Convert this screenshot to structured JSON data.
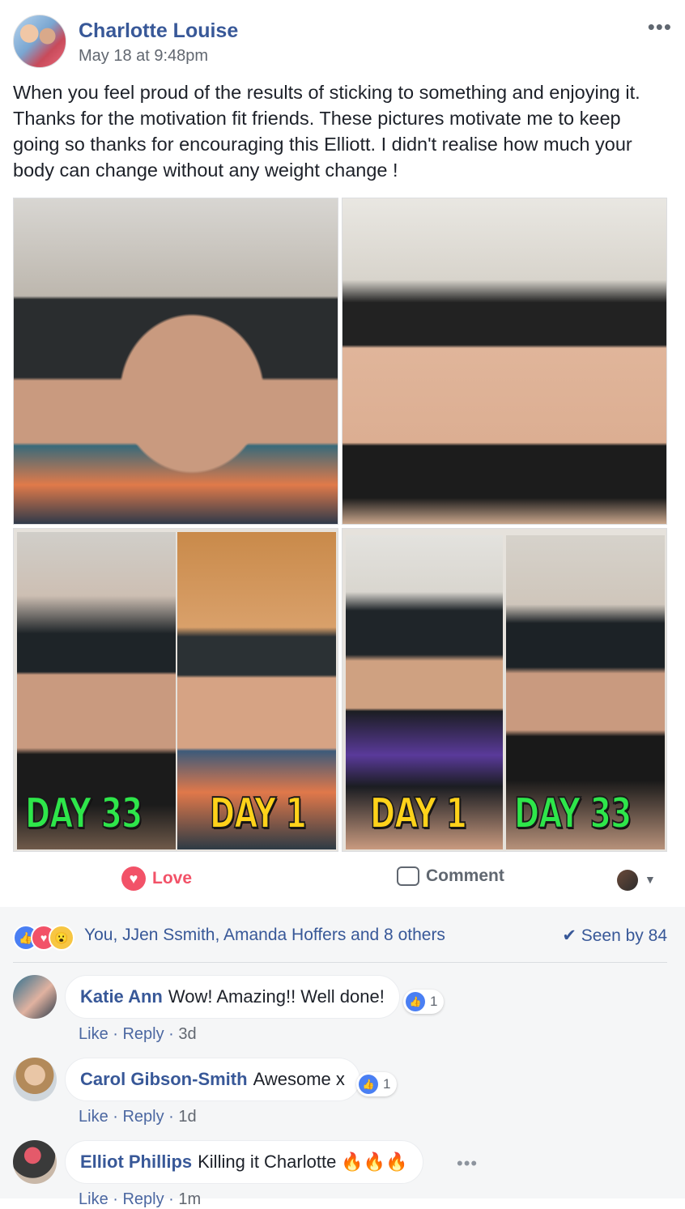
{
  "post": {
    "author": "Charlotte Louise",
    "timestamp": "May 18 at 9:48pm",
    "more_icon": "•••",
    "text": "When you feel proud of the results of sticking to something and enjoying it. Thanks for the motivation fit friends. These pictures motivate me to keep going so thanks for encouraging this Elliott. I didn't realise how much your body can change without any weight change !"
  },
  "photos": {
    "labels": [
      "DAY 33",
      "DAY 1",
      "DAY 1",
      "DAY 33"
    ]
  },
  "actions": {
    "love_label": "Love",
    "comment_label": "Comment",
    "heart_icon": "♥",
    "caret_icon": "▼"
  },
  "reactions": {
    "summary": "You, JJen Ssmith, Amanda Hoffers and 8 others",
    "seen": "✔ Seen by 84",
    "like_icon": "👍",
    "love_icon": "♥",
    "wow_icon": "😮"
  },
  "comments": [
    {
      "name": "Katie Ann",
      "text": "Wow! Amazing!! Well done!",
      "likes": "1",
      "like": "Like",
      "reply": "Reply",
      "time": "3d"
    },
    {
      "name": "Carol Gibson-Smith",
      "text": "Awesome x",
      "likes": "1",
      "like": "Like",
      "reply": "Reply",
      "time": "1d"
    },
    {
      "name": "Elliot Phillips",
      "text": "Killing it Charlotte 🔥🔥🔥",
      "like": "Like",
      "reply": "Reply",
      "time": "1m",
      "more": "•••"
    }
  ],
  "colors": {
    "link_blue": "#385898",
    "love_red": "#f25268",
    "day_green": "#2ee64a",
    "day_yellow": "#ffd21a"
  }
}
